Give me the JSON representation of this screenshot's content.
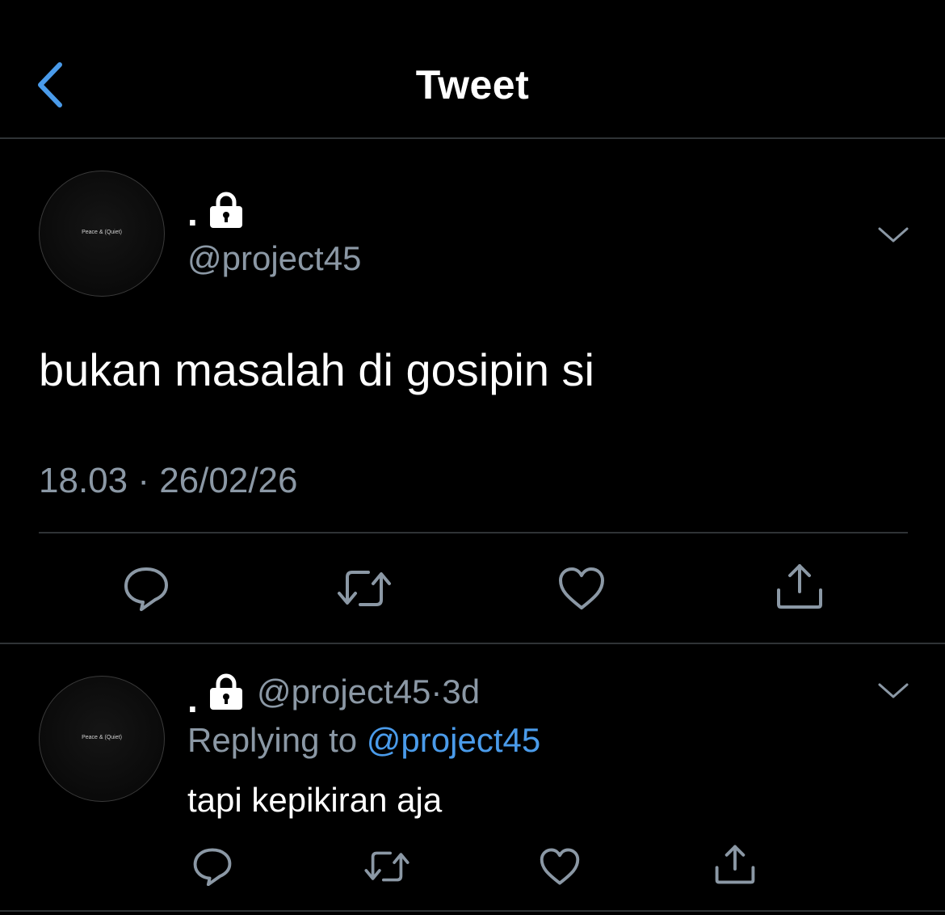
{
  "header": {
    "title": "Tweet",
    "back_icon": "chevron-left-icon"
  },
  "accent_color": "#4a9bea",
  "main_tweet": {
    "avatar_text": "Peace & (Quiet)",
    "display_name": ".",
    "handle": "@project45",
    "text": "bukan masalah di gosipin si",
    "timestamp": "18.03 · 26/02/26",
    "actions": [
      "reply-icon",
      "retweet-icon",
      "like-icon",
      "share-icon"
    ]
  },
  "reply": {
    "avatar_text": "Peace & (Quiet)",
    "display_name": ".",
    "handle": "@project45",
    "separator": "·",
    "age": "3d",
    "replying_label": "Replying to",
    "replying_handle": "@project45",
    "text": "tapi kepikiran aja",
    "actions": [
      "reply-icon",
      "retweet-icon",
      "like-icon",
      "share-icon"
    ]
  }
}
